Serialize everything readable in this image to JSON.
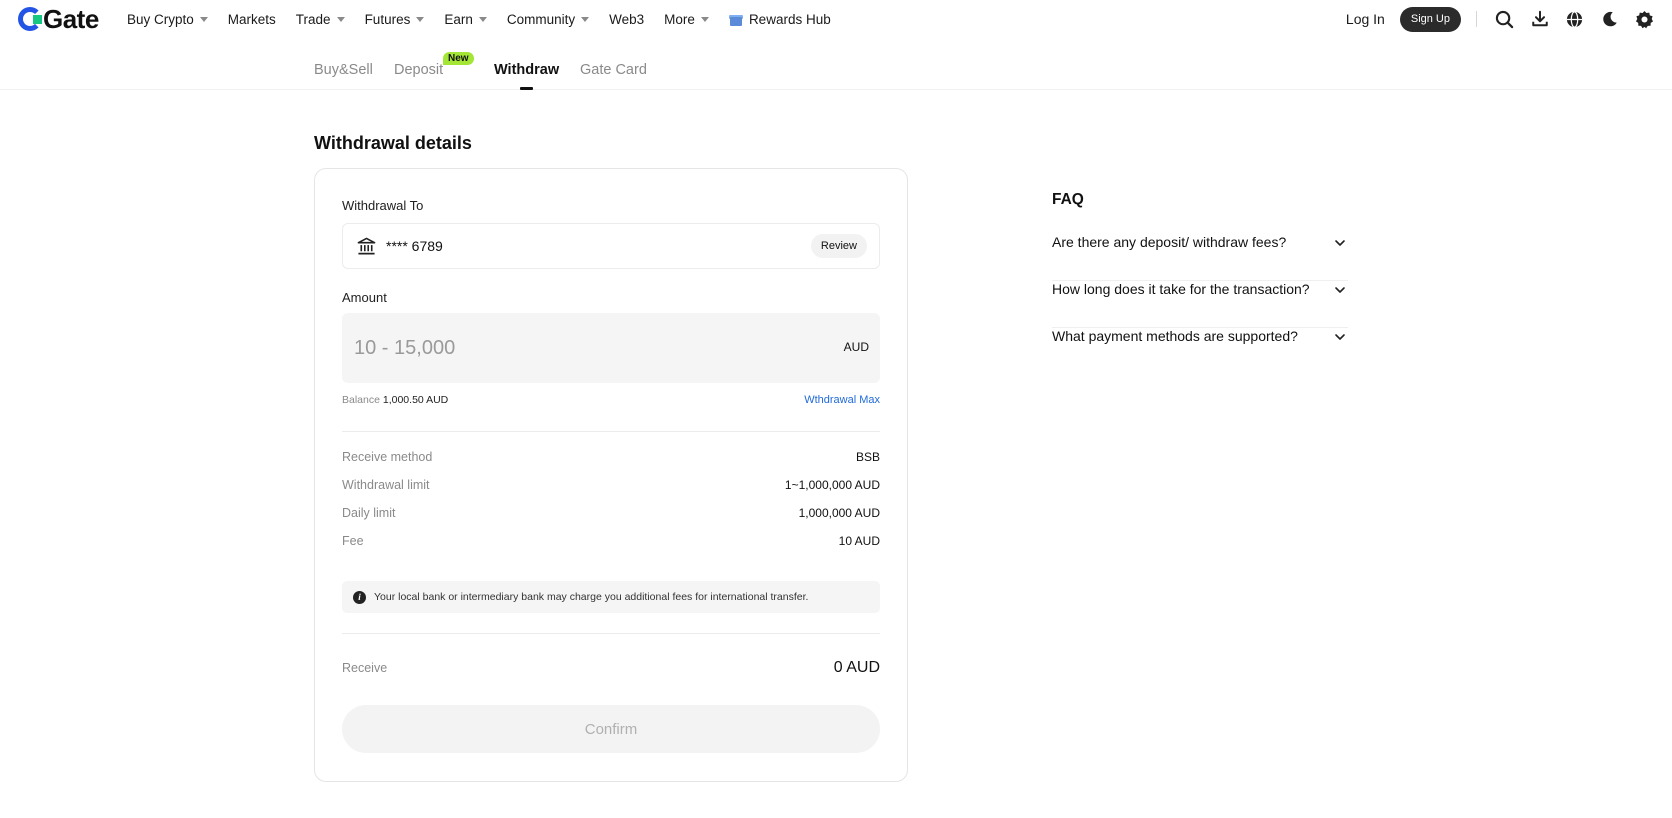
{
  "brand": {
    "name": "Gate"
  },
  "nav": {
    "items": [
      {
        "label": "Buy Crypto",
        "dropdown": true
      },
      {
        "label": "Markets",
        "dropdown": false
      },
      {
        "label": "Trade",
        "dropdown": true
      },
      {
        "label": "Futures",
        "dropdown": true
      },
      {
        "label": "Earn",
        "dropdown": true
      },
      {
        "label": "Community",
        "dropdown": true
      },
      {
        "label": "Web3",
        "dropdown": false
      },
      {
        "label": "More",
        "dropdown": true
      }
    ],
    "rewards_hub": "Rewards Hub",
    "login": "Log In",
    "signup": "Sign Up",
    "tools": [
      "search-icon",
      "download-icon",
      "globe-icon",
      "moon-icon",
      "gear-icon"
    ]
  },
  "tabs": {
    "buy_sell": "Buy&Sell",
    "deposit": "Deposit",
    "deposit_badge": "New",
    "withdraw": "Withdraw",
    "gate_card": "Gate Card"
  },
  "page": {
    "title": "Withdrawal details"
  },
  "withdraw": {
    "to_label": "Withdrawal To",
    "account_masked": "**** 6789",
    "review_label": "Review",
    "amount_label": "Amount",
    "amount_placeholder": "10 - 15,000",
    "amount_currency": "AUD",
    "balance_label": "Balance",
    "balance_value": "1,000.50 AUD",
    "max_label": "Wthdrawal Max",
    "details": [
      {
        "key": "Receive method",
        "value": "BSB"
      },
      {
        "key": "Withdrawal limit",
        "value": "1~1,000,000 AUD"
      },
      {
        "key": "Daily limit",
        "value": "1,000,000 AUD"
      },
      {
        "key": "Fee",
        "value": "10 AUD"
      }
    ],
    "notice": "Your local bank or intermediary bank may charge you additional fees for international transfer.",
    "receive_label": "Receive",
    "receive_value": "0 AUD",
    "confirm_label": "Confirm"
  },
  "faq": {
    "title": "FAQ",
    "items": [
      "Are there any deposit/ withdraw fees?",
      "How long does it take for the transaction?",
      "What payment methods are supported?"
    ]
  },
  "colors": {
    "accent": "#2354e6",
    "link": "#1f6ad8",
    "badge": "#a3e635",
    "dark": "#2b2b2b"
  }
}
